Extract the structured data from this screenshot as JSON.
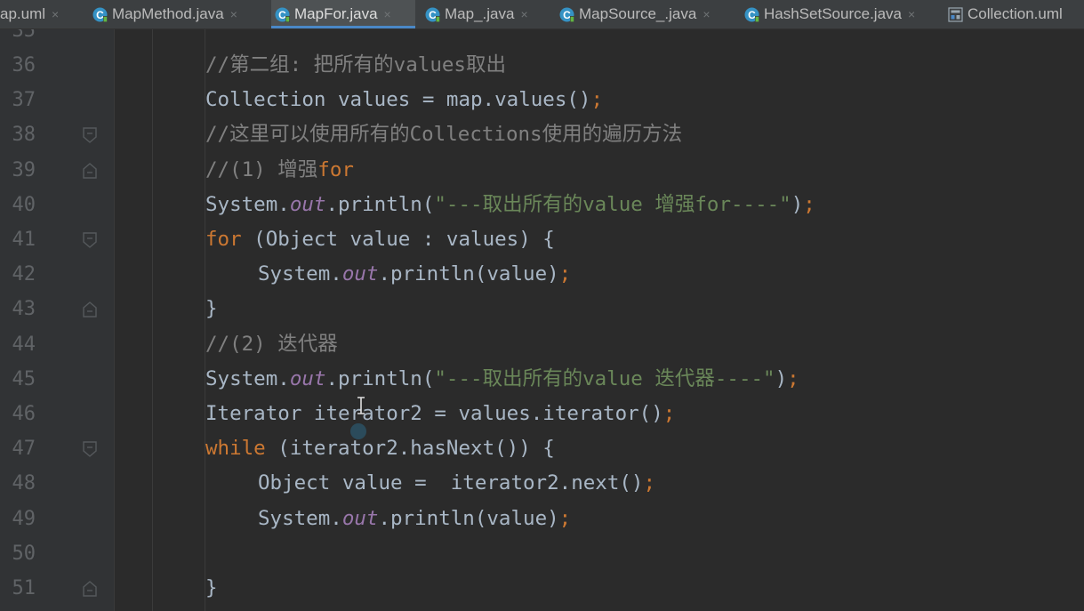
{
  "colors": {
    "background": "#2b2b2b",
    "keyword": "#cc7832",
    "static_field": "#9876aa",
    "string": "#6a8759",
    "comment": "#808080",
    "plain": "#a9b7c6",
    "line_number": "#606366",
    "active_tab_underline": "#4a88c7"
  },
  "tabs": [
    {
      "label": "ap.uml",
      "icon": "uml-file-icon",
      "active": false
    },
    {
      "label": "MapMethod.java",
      "icon": "java-class-icon",
      "active": false
    },
    {
      "label": "MapFor.java",
      "icon": "java-class-icon",
      "active": true
    },
    {
      "label": "Map_.java",
      "icon": "java-class-icon",
      "active": false
    },
    {
      "label": "MapSource_.java",
      "icon": "java-class-icon",
      "active": false
    },
    {
      "label": "HashSetSource.java",
      "icon": "java-class-icon",
      "active": false
    },
    {
      "label": "Collection.uml",
      "icon": "uml-diagram-icon",
      "active": false
    }
  ],
  "editor": {
    "partial_top_line_number": "35",
    "lines": [
      {
        "number": "36",
        "indent": 2,
        "fold": "none",
        "tokens": [
          {
            "t": "cmt",
            "v": "//第二组: 把所有的values取出"
          }
        ]
      },
      {
        "number": "37",
        "indent": 2,
        "fold": "none",
        "tokens": [
          {
            "t": "plain",
            "v": "Collection values = map.values()"
          },
          {
            "t": "semi",
            "v": ";"
          }
        ]
      },
      {
        "number": "38",
        "indent": 2,
        "fold": "start",
        "tokens": [
          {
            "t": "cmt",
            "v": "//这里可以使用所有的Collections使用的遍历方法"
          }
        ]
      },
      {
        "number": "39",
        "indent": 2,
        "fold": "end",
        "tokens": [
          {
            "t": "cmt",
            "v": "//(1) 增强"
          },
          {
            "t": "kw",
            "v": "for"
          }
        ]
      },
      {
        "number": "40",
        "indent": 2,
        "fold": "none",
        "tokens": [
          {
            "t": "plain",
            "v": "System."
          },
          {
            "t": "out",
            "v": "out"
          },
          {
            "t": "plain",
            "v": ".println("
          },
          {
            "t": "str",
            "v": "\"---取出所有的value 增强for----\""
          },
          {
            "t": "plain",
            "v": ")"
          },
          {
            "t": "semi",
            "v": ";"
          }
        ]
      },
      {
        "number": "41",
        "indent": 2,
        "fold": "start",
        "tokens": [
          {
            "t": "kw",
            "v": "for"
          },
          {
            "t": "plain",
            "v": " (Object value : values) {"
          }
        ]
      },
      {
        "number": "42",
        "indent": 3,
        "fold": "none",
        "tokens": [
          {
            "t": "plain",
            "v": "System."
          },
          {
            "t": "out",
            "v": "out"
          },
          {
            "t": "plain",
            "v": ".println(value)"
          },
          {
            "t": "semi",
            "v": ";"
          }
        ]
      },
      {
        "number": "43",
        "indent": 2,
        "fold": "end",
        "tokens": [
          {
            "t": "plain",
            "v": "}"
          }
        ]
      },
      {
        "number": "44",
        "indent": 2,
        "fold": "none",
        "tokens": [
          {
            "t": "cmt",
            "v": "//(2) 迭代器"
          }
        ]
      },
      {
        "number": "45",
        "indent": 2,
        "fold": "none",
        "tokens": [
          {
            "t": "plain",
            "v": "System."
          },
          {
            "t": "out",
            "v": "out"
          },
          {
            "t": "plain",
            "v": ".println("
          },
          {
            "t": "str",
            "v": "\"---取出所有的value 迭代器----\""
          },
          {
            "t": "plain",
            "v": ")"
          },
          {
            "t": "semi",
            "v": ";"
          }
        ]
      },
      {
        "number": "46",
        "indent": 2,
        "fold": "none",
        "tokens": [
          {
            "t": "plain",
            "v": "Iterator iterator2 = values.iterator()"
          },
          {
            "t": "semi",
            "v": ";"
          }
        ]
      },
      {
        "number": "47",
        "indent": 2,
        "fold": "start",
        "tokens": [
          {
            "t": "kw",
            "v": "while"
          },
          {
            "t": "plain",
            "v": " (iterator2.hasNext()) {"
          }
        ]
      },
      {
        "number": "48",
        "indent": 3,
        "fold": "none",
        "tokens": [
          {
            "t": "plain",
            "v": "Object value =  iterator2.next()"
          },
          {
            "t": "semi",
            "v": ";"
          }
        ]
      },
      {
        "number": "49",
        "indent": 3,
        "fold": "none",
        "tokens": [
          {
            "t": "plain",
            "v": "System."
          },
          {
            "t": "out",
            "v": "out"
          },
          {
            "t": "plain",
            "v": ".println(value)"
          },
          {
            "t": "semi",
            "v": ";"
          }
        ]
      },
      {
        "number": "50",
        "indent": 3,
        "fold": "none",
        "tokens": []
      },
      {
        "number": "51",
        "indent": 2,
        "fold": "end",
        "tokens": [
          {
            "t": "plain",
            "v": "}"
          }
        ]
      }
    ]
  }
}
